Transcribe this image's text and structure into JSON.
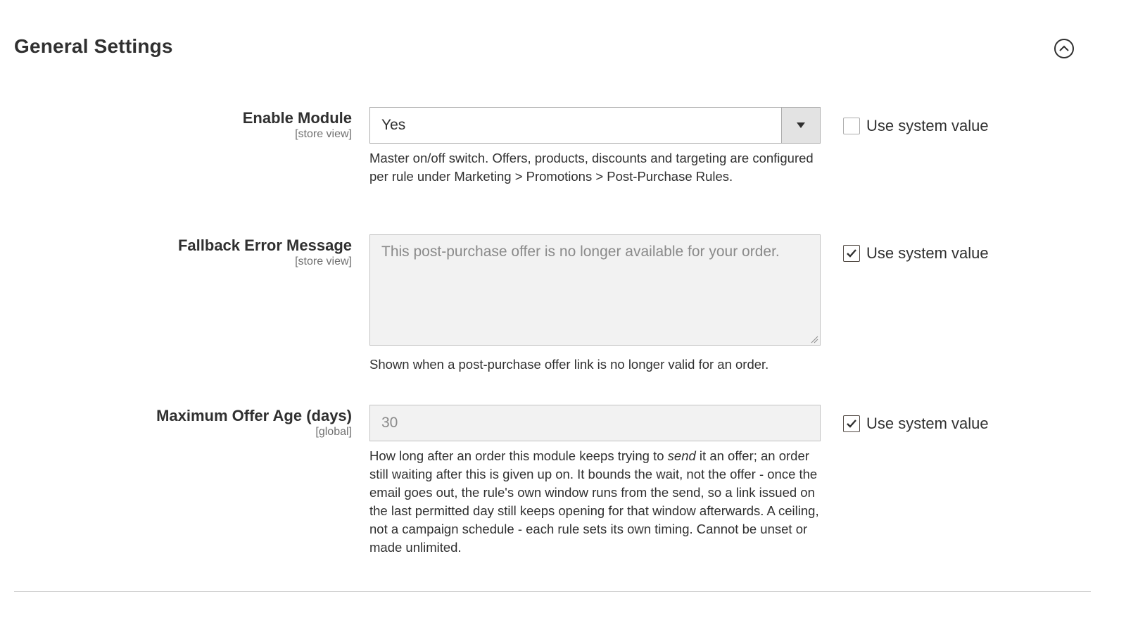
{
  "section": {
    "title": "General Settings",
    "collapse_icon": "chevron-up-circle-icon"
  },
  "fields": {
    "enable_module": {
      "label": "Enable Module",
      "scope": "[store view]",
      "value": "Yes",
      "note": "Master on/off switch. Offers, products, discounts and targeting are configured per rule under Marketing > Promotions > Post-Purchase Rules.",
      "use_system_value": false,
      "use_system_label": "Use system value"
    },
    "fallback_error": {
      "label": "Fallback Error Message",
      "scope": "[store view]",
      "value": "This post-purchase offer is no longer available for your order.",
      "note": "Shown when a post-purchase offer link is no longer valid for an order.",
      "use_system_value": true,
      "use_system_label": "Use system value"
    },
    "max_offer_age": {
      "label": "Maximum Offer Age (days)",
      "scope": "[global]",
      "value": "30",
      "note_pre": "How long after an order this module keeps trying to ",
      "note_em": "send",
      "note_post": " it an offer; an order still waiting after this is given up on. It bounds the wait, not the offer - once the email goes out, the rule's own window runs from the send, so a link issued on the last permitted day still keeps opening for that window afterwards. A ceiling, not a campaign schedule - each rule sets its own timing. Cannot be unset or made unlimited.",
      "use_system_value": true,
      "use_system_label": "Use system value"
    }
  }
}
